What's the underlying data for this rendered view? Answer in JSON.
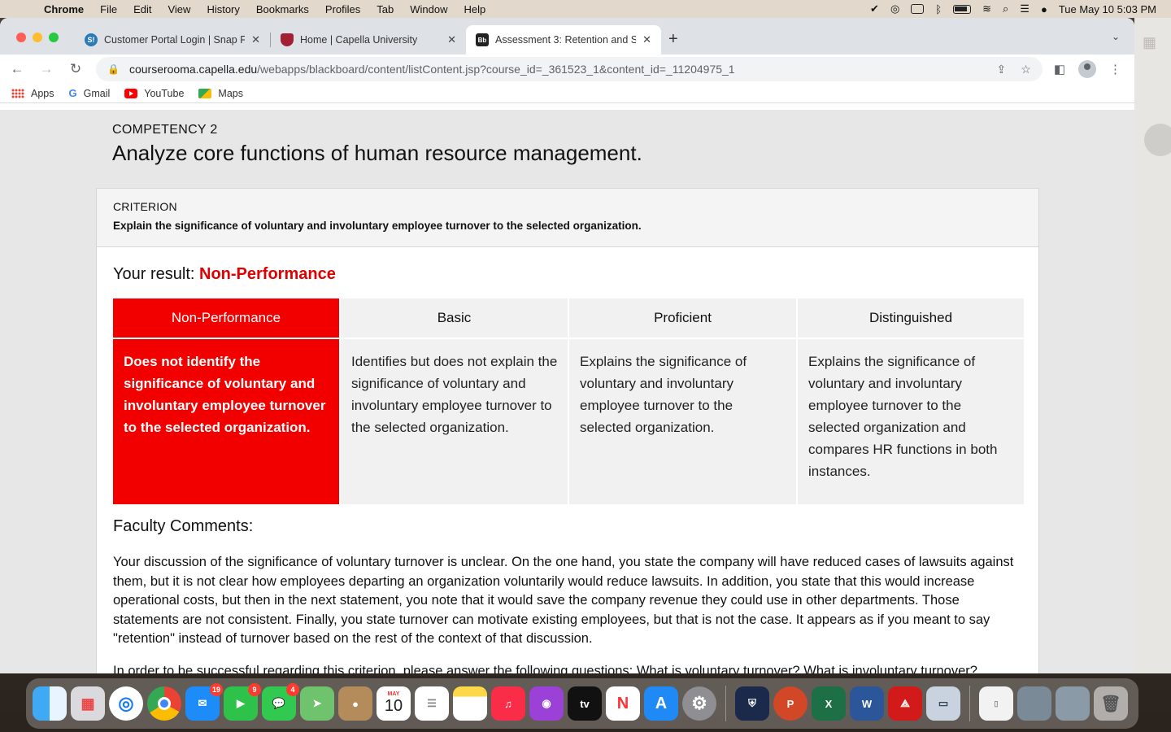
{
  "menubar": {
    "app": "Chrome",
    "items": [
      "File",
      "Edit",
      "View",
      "History",
      "Bookmarks",
      "Profiles",
      "Tab",
      "Window",
      "Help"
    ],
    "clock": "Tue May 10  5:03 PM"
  },
  "tabs": [
    {
      "title": "Customer Portal Login | Snap F",
      "favicon": "S!",
      "color": "#2a7ab8"
    },
    {
      "title": "Home | Capella University",
      "favicon": "shield",
      "color": "#a31f34"
    },
    {
      "title": "Assessment 3: Retention and S",
      "favicon": "Bb",
      "color": "#222222"
    }
  ],
  "address": {
    "domain": "courserooma.capella.edu",
    "path": "/webapps/blackboard/content/listContent.jsp?course_id=_361523_1&content_id=_11204975_1"
  },
  "bookmarks": [
    "Apps",
    "Gmail",
    "YouTube",
    "Maps"
  ],
  "competency": {
    "label": "COMPETENCY 2",
    "title": "Analyze core functions of human resource management."
  },
  "criterion": {
    "label": "CRITERION",
    "text": "Explain the significance of voluntary and involuntary employee turnover to the selected organization."
  },
  "result": {
    "label": "Your result: ",
    "value": "Non-Performance"
  },
  "rubric": {
    "headers": [
      "Non-Performance",
      "Basic",
      "Proficient",
      "Distinguished"
    ],
    "cells": [
      "Does not identify the significance of voluntary and involuntary employee turnover to the selected organization.",
      "Identifies but does not explain the significance of voluntary and involuntary employee turnover to the selected organization.",
      "Explains the significance of voluntary and involuntary employee turnover to the selected organization.",
      "Explains the significance of voluntary and involuntary employee turnover to the selected organization and compares HR functions in both instances."
    ]
  },
  "faculty": {
    "title": "Faculty Comments:",
    "paragraph1": "Your discussion of the significance of voluntary turnover is unclear. On the one hand, you state the company will have reduced cases of lawsuits against them, but it is not clear how employees departing an organization voluntarily would reduce lawsuits. In addition, you state that this would increase operational costs, but then in the next statement, you note that it would save the company revenue they could use in other departments. Those statements are not consistent. Finally, you state turnover can motivate existing employees, but that is not the case. It appears as if you meant to say \"retention\" instead of turnover based on the rest of the context of that discussion.",
    "paragraph2": "In order to be successful regarding this criterion, please answer the following questions: What is voluntary turnover? What is involuntary turnover?"
  },
  "dock": {
    "calendar_month": "MAY",
    "calendar_day": "10",
    "tv_label": "tv",
    "badges": {
      "mail": "19",
      "facetime": "9",
      "messages": "4"
    }
  }
}
